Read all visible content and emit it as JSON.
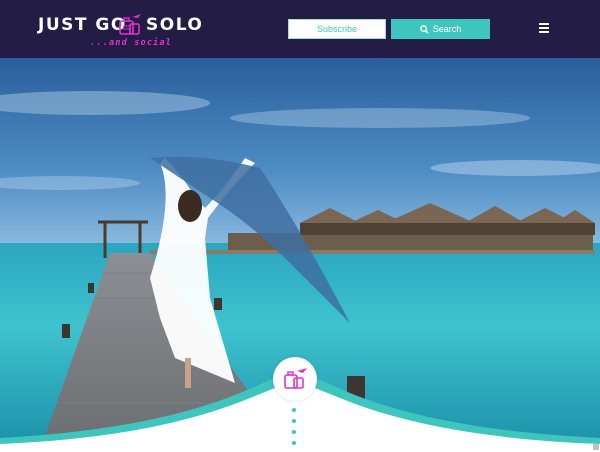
{
  "header": {
    "logo": {
      "text_left": "JUST GO",
      "text_right": "SOLO",
      "tagline": "...and social"
    },
    "subscribe_label": "Subscribe",
    "search_label": "Search",
    "menu_icon": "hamburger-menu-icon"
  },
  "hero": {
    "image": "woman-on-boardwalk-maldives-water-villas",
    "badge_icon": "suitcase-plane-icon"
  },
  "colors": {
    "header_bg": "#231c45",
    "accent_teal": "#3ec6be",
    "accent_magenta": "#e52fd3"
  }
}
